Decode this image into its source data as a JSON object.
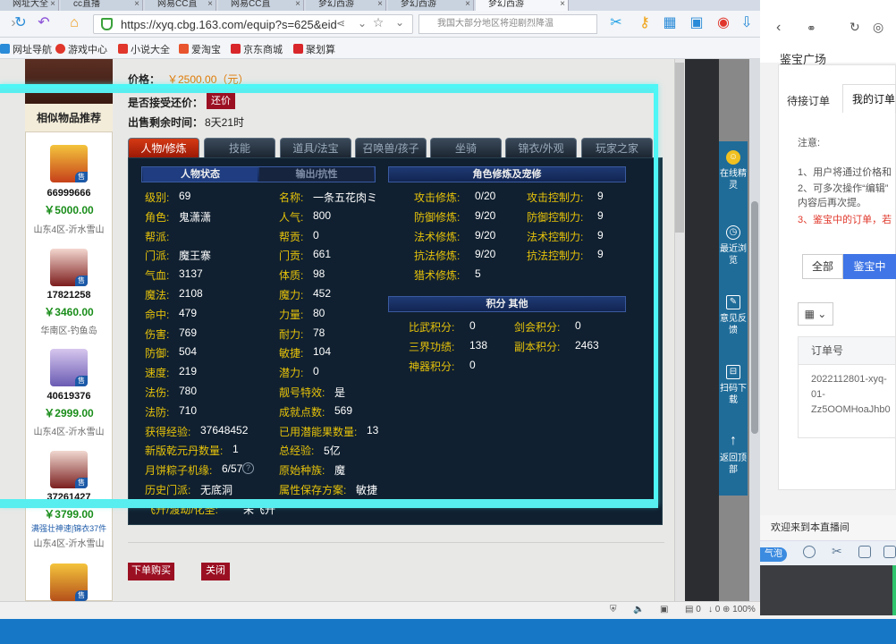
{
  "browser": {
    "tabs": [
      {
        "label": "网址大全"
      },
      {
        "label": "cc直播"
      },
      {
        "label": "网易CC直"
      },
      {
        "label": "网易CC直"
      },
      {
        "label": "梦幻西游"
      },
      {
        "label": "梦幻西游"
      },
      {
        "label": "梦幻西游"
      }
    ],
    "url": "https://xyq.cbg.163.com/equip?s=625&eid",
    "search_placeholder": "我国大部分地区将迎剧烈降温"
  },
  "bookmarks": [
    {
      "label": "网址导航",
      "color": "#2a8bd8"
    },
    {
      "label": "游戏中心",
      "color": "#e0362b"
    },
    {
      "label": "小说大全",
      "color": "#e0362b"
    },
    {
      "label": "爱淘宝",
      "color": "#e8542e"
    },
    {
      "label": "京东商城",
      "color": "#d8262a"
    },
    {
      "label": "聚划算",
      "color": "#d8262a"
    }
  ],
  "listing": {
    "price_label": "价格：",
    "price_value": "￥2500.00（元）",
    "bargain_label": "是否接受还价：",
    "bargain_button": "还价",
    "time_label": "出售剩余时间：",
    "time_value": "8天21时"
  },
  "similar": {
    "title": "相似物品推荐",
    "sell_tag": "售",
    "items": [
      {
        "id": "66999666",
        "price": "￥5000.00",
        "server": "山东4区-沂水雪山"
      },
      {
        "id": "17821258",
        "price": "￥3460.00",
        "server": "华南区-钓鱼岛"
      },
      {
        "id": "40619376",
        "price": "￥2999.00",
        "server": "山东4区-沂水雪山"
      },
      {
        "id": "37261427",
        "price": "￥3799.00",
        "tag": "满强壮神速|锦衣37件",
        "server": "山东4区-沂水雪山"
      }
    ]
  },
  "game_tabs": [
    {
      "label": "人物/修炼",
      "active": true
    },
    {
      "label": "技能"
    },
    {
      "label": "道具/法宝"
    },
    {
      "label": "召唤兽/孩子"
    },
    {
      "label": "坐骑"
    },
    {
      "label": "锦衣/外观"
    },
    {
      "label": "玩家之家"
    }
  ],
  "char": {
    "subtab_active": "人物状态",
    "subtab_other": "输出/抗性",
    "left_col": [
      {
        "label": "级别:",
        "value": "69"
      },
      {
        "label": "角色:",
        "value": "鬼潇潇"
      },
      {
        "label": "帮派:",
        "value": ""
      },
      {
        "label": "门派:",
        "value": "魔王寨"
      },
      {
        "label": "气血:",
        "value": "3137"
      },
      {
        "label": "魔法:",
        "value": "2108"
      },
      {
        "label": "命中:",
        "value": "479"
      },
      {
        "label": "伤害:",
        "value": "769"
      },
      {
        "label": "防御:",
        "value": "504"
      },
      {
        "label": "速度:",
        "value": "219"
      },
      {
        "label": "法伤:",
        "value": "780"
      },
      {
        "label": "法防:",
        "value": "710"
      },
      {
        "label": "获得经验:",
        "value": "37648452"
      },
      {
        "label": "新版乾元丹数量:",
        "value": "1"
      },
      {
        "label": "月饼粽子机缘:",
        "value": "6/57"
      },
      {
        "label": "历史门派:",
        "value": "无底洞"
      },
      {
        "label": "飞升/渡劫/化圣:",
        "value": "未飞升"
      }
    ],
    "right_col": [
      {
        "label": "名称:",
        "value": "一条五花肉ミ"
      },
      {
        "label": "人气:",
        "value": "800"
      },
      {
        "label": "帮贡:",
        "value": "0"
      },
      {
        "label": "门贡:",
        "value": "661"
      },
      {
        "label": "体质:",
        "value": "98"
      },
      {
        "label": "魔力:",
        "value": "452"
      },
      {
        "label": "力量:",
        "value": "80"
      },
      {
        "label": "耐力:",
        "value": "78"
      },
      {
        "label": "敏捷:",
        "value": "104"
      },
      {
        "label": "潜力:",
        "value": "0"
      },
      {
        "label": "靓号特效:",
        "value": "是"
      },
      {
        "label": "成就点数:",
        "value": "569"
      },
      {
        "label": "已用潜能果数量:",
        "value": "13"
      },
      {
        "label": "总经验:",
        "value": "5亿"
      },
      {
        "label": "原始种族:",
        "value": "魔"
      },
      {
        "label": "属性保存方案:",
        "value": "敏捷"
      }
    ],
    "cultivation_title": "角色修炼及宠修",
    "cultivation": [
      {
        "l1": "攻击修炼:",
        "v1": "0/20",
        "l2": "攻击控制力:",
        "v2": "9"
      },
      {
        "l1": "防御修炼:",
        "v1": "9/20",
        "l2": "防御控制力:",
        "v2": "9"
      },
      {
        "l1": "法术修炼:",
        "v1": "9/20",
        "l2": "法术控制力:",
        "v2": "9"
      },
      {
        "l1": "抗法修炼:",
        "v1": "9/20",
        "l2": "抗法控制力:",
        "v2": "9"
      },
      {
        "l1": "猎术修炼:",
        "v1": "5",
        "l2": "",
        "v2": ""
      }
    ],
    "score_title": "积分 其他",
    "scores": [
      {
        "l1": "比武积分:",
        "v1": "0",
        "l2": "剑会积分:",
        "v2": "0"
      },
      {
        "l1": "三界功绩:",
        "v1": "138",
        "l2": "副本积分:",
        "v2": "2463"
      },
      {
        "l1": "神器积分:",
        "v1": "0",
        "l2": "",
        "v2": ""
      }
    ]
  },
  "actions": {
    "buy": "下单购买",
    "close": "关闭"
  },
  "side_panel": [
    {
      "label": "在线精灵",
      "icon": "sprite-icon"
    },
    {
      "label": "最近浏览",
      "icon": "clock-icon"
    },
    {
      "label": "意见反馈",
      "icon": "edit-icon"
    },
    {
      "label": "扫码下载",
      "icon": "scan-icon"
    },
    {
      "label": "返回顶部",
      "icon": "arrow-up-icon"
    }
  ],
  "right_panel": {
    "header": "鉴宝广场",
    "tab_pending": "待接订单",
    "tab_mine": "我的订单",
    "note_title": "注意:",
    "notes": [
      "1、用户将通过价格和",
      "2、可多次操作“编辑”",
      "内容后再次提。",
      "3、鉴宝中的订单，若"
    ],
    "filter_all": "全部",
    "filter_active": "鉴宝中",
    "table_header": "订单号",
    "order_no": [
      "2022112801-xyq-",
      "01-",
      "Zz5OOMHoaJhb0"
    ],
    "welcome": "欢迎来到本直播间",
    "bubble": "气泡"
  },
  "statusbar": {
    "counter1": "0",
    "counter2": "0",
    "zoom": "100%"
  }
}
